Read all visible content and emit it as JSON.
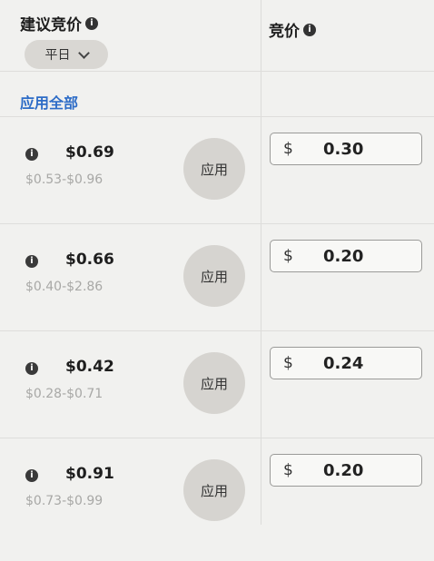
{
  "header": {
    "suggested_bid_label": "建议竞价",
    "bid_label": "竞价",
    "info_glyph": "i",
    "period_select": "平日",
    "apply_all": "应用全部"
  },
  "rows": [
    {
      "info": "i",
      "suggested": "$0.69",
      "range": "$0.53-$0.96",
      "apply": "应用",
      "currency": "$",
      "bid": "0.30"
    },
    {
      "info": "i",
      "suggested": "$0.66",
      "range": "$0.40-$2.86",
      "apply": "应用",
      "currency": "$",
      "bid": "0.20"
    },
    {
      "info": "i",
      "suggested": "$0.42",
      "range": "$0.28-$0.71",
      "apply": "应用",
      "currency": "$",
      "bid": "0.24"
    },
    {
      "info": "i",
      "suggested": "$0.91",
      "range": "$0.73-$0.99",
      "apply": "应用",
      "currency": "$",
      "bid": "0.20"
    }
  ]
}
